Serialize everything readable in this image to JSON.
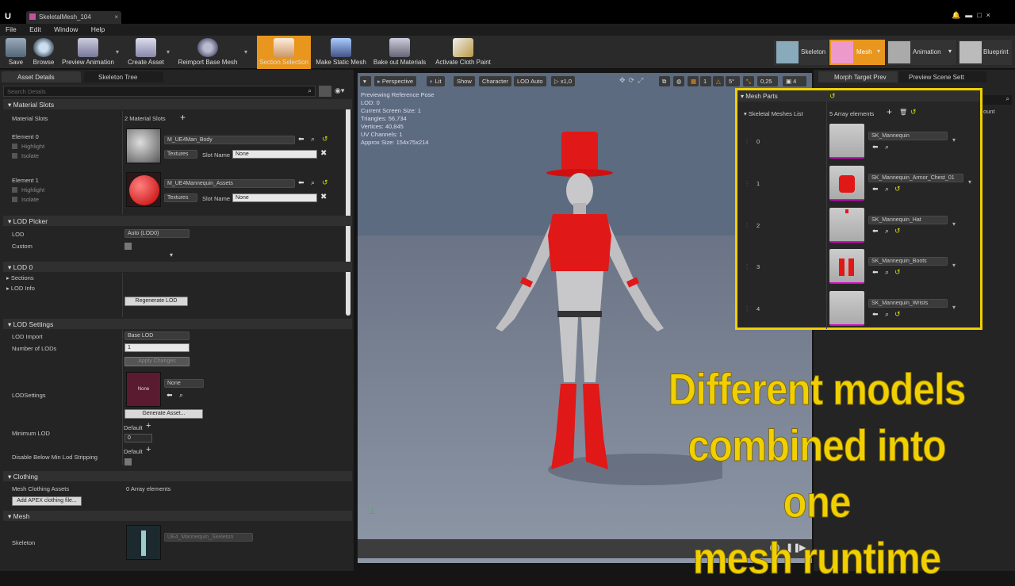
{
  "window": {
    "tab_title": "SkeletalMesh_104"
  },
  "menu": [
    "File",
    "Edit",
    "Window",
    "Help"
  ],
  "toolbar": {
    "buttons": [
      {
        "label": "Save"
      },
      {
        "label": "Browse"
      },
      {
        "label": "Preview Animation"
      },
      {
        "label": "Create Asset"
      },
      {
        "label": "Reimport Base Mesh"
      },
      {
        "label": "Section Selection"
      },
      {
        "label": "Make Static Mesh"
      },
      {
        "label": "Bake out Materials"
      },
      {
        "label": "Activate Cloth Paint"
      }
    ],
    "modes": [
      {
        "label": "Skeleton"
      },
      {
        "label": "Mesh"
      },
      {
        "label": "Animation"
      },
      {
        "label": "Blueprint"
      }
    ]
  },
  "left_panel": {
    "tabs": [
      "Asset Details",
      "Skeleton Tree"
    ],
    "search_placeholder": "Search Details",
    "material_slots": {
      "header": "Material Slots",
      "label": "Material Slots",
      "count": "2 Material Slots",
      "elements": [
        {
          "name": "Element 0",
          "highlight": "Highlight",
          "isolate": "Isolate",
          "material": "M_UE4Man_Body",
          "textures": "Textures",
          "slot_name_label": "Slot Name",
          "slot_name": "None"
        },
        {
          "name": "Element 1",
          "highlight": "Highlight",
          "isolate": "Isolate",
          "material": "M_UE4Mannequin_Assets",
          "textures": "Textures",
          "slot_name_label": "Slot Name",
          "slot_name": "None"
        }
      ]
    },
    "lod_picker": {
      "header": "LOD Picker",
      "lod_label": "LOD",
      "lod_value": "Auto (LOD0)",
      "custom_label": "Custom"
    },
    "lod0": {
      "header": "LOD 0",
      "sections": "Sections",
      "lod_info": "LOD Info",
      "regen_button": "Regenerate LOD"
    },
    "lod_settings": {
      "header": "LOD Settings",
      "lod_import_label": "LOD Import",
      "lod_import_value": "Base LOD",
      "num_lods_label": "Number of LODs",
      "num_lods_value": "1",
      "apply_button": "Apply Changes",
      "lod_settings_label": "LODSettings",
      "lod_settings_thumb": "None",
      "lod_settings_value": "None",
      "generate_button": "Generate Asset...",
      "min_lod_label": "Minimum LOD",
      "min_lod_default": "Default",
      "min_lod_value": "0",
      "disable_label": "Disable Below Min Lod Stripping",
      "disable_default": "Default"
    },
    "clothing": {
      "header": "Clothing",
      "assets_label": "Mesh Clothing Assets",
      "assets_value": "0 Array elements",
      "add_button": "Add APEX clothing file..."
    },
    "mesh": {
      "header": "Mesh",
      "skeleton_label": "Skeleton",
      "skeleton_value": "UE4_Mannequin_Skeleton"
    }
  },
  "viewport": {
    "buttons": [
      "Perspective",
      "Lit",
      "Show",
      "Character",
      "LOD Auto",
      "x1,0"
    ],
    "snap_values": [
      "5°",
      "0,25",
      "4"
    ],
    "stats": [
      "Previewing Reference Pose",
      "LOD: 0",
      "Current Screen Size: 1",
      "Triangles: 56,734",
      "Vertices: 40,845",
      "UV Channels: 1",
      "Approx Size: 154x75x214"
    ]
  },
  "right_panel": {
    "tabs": [
      "Morph Target Prev",
      "Preview Scene Sett"
    ],
    "partial_text": "ount"
  },
  "mesh_parts": {
    "header": "Mesh Parts",
    "list_label": "Skeletal Meshes List",
    "count": "5 Array elements",
    "items": [
      {
        "index": "0",
        "name": "SK_Mannequin"
      },
      {
        "index": "1",
        "name": "SK_Mannequin_Armor_Chest_01"
      },
      {
        "index": "2",
        "name": "SK_Mannequin_Hat"
      },
      {
        "index": "3",
        "name": "SK_Mannequin_Boots"
      },
      {
        "index": "4",
        "name": "SK_Mannequin_Wrists"
      }
    ]
  },
  "caption": [
    "Different models",
    "combined into one",
    "mesh runtime"
  ],
  "colors": {
    "accent": "#f0d000",
    "selected": "#e8961e",
    "red": "#e02020"
  }
}
